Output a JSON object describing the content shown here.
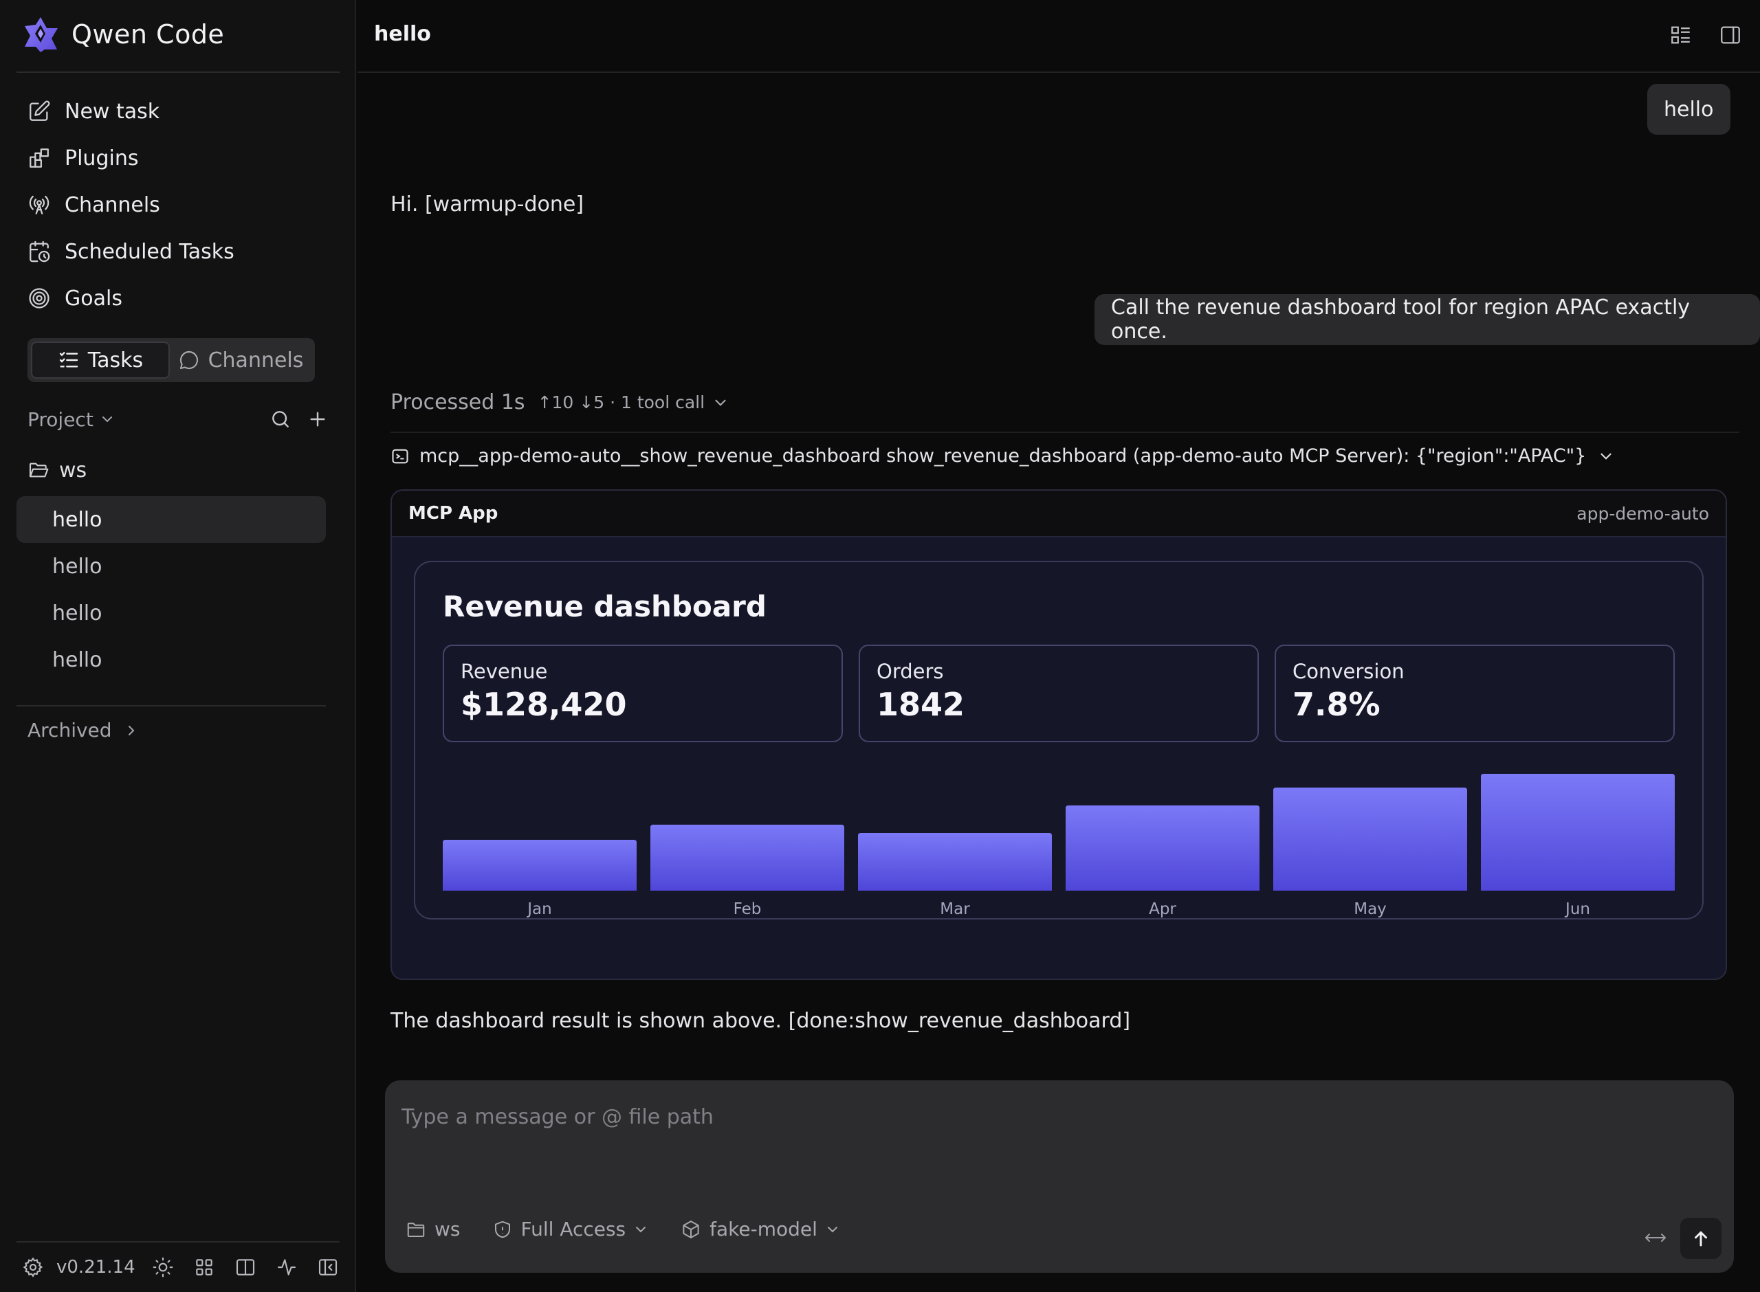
{
  "brand": {
    "title": "Qwen Code"
  },
  "nav": {
    "items": [
      {
        "label": "New task",
        "icon": "edit-icon"
      },
      {
        "label": "Plugins",
        "icon": "plugins-icon"
      },
      {
        "label": "Channels",
        "icon": "broadcast-icon"
      },
      {
        "label": "Scheduled Tasks",
        "icon": "calendar-clock-icon"
      },
      {
        "label": "Goals",
        "icon": "target-icon"
      }
    ]
  },
  "segment": {
    "tasks_label": "Tasks",
    "channels_label": "Channels",
    "selected": "Tasks"
  },
  "project": {
    "label": "Project",
    "folder": "ws"
  },
  "tasks": [
    "hello",
    "hello",
    "hello",
    "hello"
  ],
  "archived_label": "Archived",
  "footer": {
    "version": "v0.21.14"
  },
  "header": {
    "title": "hello"
  },
  "messages": {
    "user_1": "hello",
    "assistant_1": "Hi. [warmup-done]",
    "user_2": "Call the revenue dashboard tool for region APAC exactly once.",
    "processed": "Processed 1s",
    "processed_meta": "↑10 ↓5 · 1 tool call",
    "tool_call": "mcp__app-demo-auto__show_revenue_dashboard show_revenue_dashboard (app-demo-auto MCP Server): {\"region\":\"APAC\"}",
    "assistant_2": "The dashboard result is shown above. [done:show_revenue_dashboard]"
  },
  "mcp_app": {
    "header": "MCP App",
    "source": "app-demo-auto",
    "dashboard_title": "Revenue dashboard",
    "kpis": [
      {
        "label": "Revenue",
        "value": "$128,420"
      },
      {
        "label": "Orders",
        "value": "1842"
      },
      {
        "label": "Conversion",
        "value": "7.8%"
      }
    ]
  },
  "chart_data": {
    "type": "bar",
    "categories": [
      "Jan",
      "Feb",
      "Mar",
      "Apr",
      "May",
      "Jun"
    ],
    "values": [
      74,
      96,
      84,
      124,
      150,
      170
    ],
    "title": "",
    "xlabel": "",
    "ylabel": "",
    "ylim": [
      0,
      170
    ],
    "grid": false,
    "colors": {
      "bar_top": "#7b79f7",
      "bar_bottom": "#4f46d8"
    }
  },
  "composer": {
    "placeholder": "Type a message or @ file path",
    "folder": "ws",
    "access": "Full Access",
    "model": "fake-model"
  },
  "colors": {
    "accent": "#6c63ff",
    "background": "#0b0b0c",
    "sidebar": "#121213"
  }
}
